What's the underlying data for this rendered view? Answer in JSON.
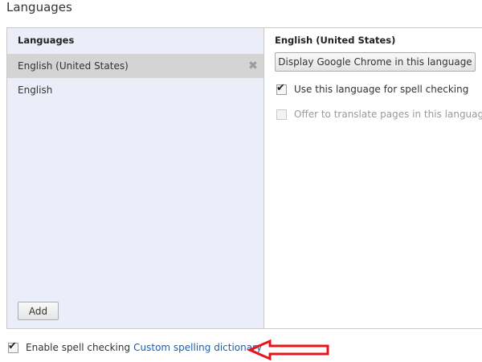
{
  "section": {
    "title": "Languages"
  },
  "languages_list": {
    "header": "Languages",
    "items": [
      {
        "label": "English (United States)",
        "selected": true
      },
      {
        "label": "English",
        "selected": false
      }
    ],
    "add_label": "Add",
    "remove_icon": "close-icon"
  },
  "details": {
    "header": "English (United States)",
    "display_button": "Display Google Chrome in this language",
    "spell_check_label": "Use this language for spell checking",
    "spell_check_checked": true,
    "translate_label": "Offer to translate pages in this language",
    "translate_checked": false,
    "translate_disabled": true
  },
  "footer": {
    "enable_spell_label": "Enable spell checking",
    "enable_spell_checked": true,
    "custom_dict_link": "Custom spelling dictionary"
  },
  "annotation": {
    "arrow_color": "#e8141c",
    "icon": "red-arrow-icon"
  }
}
